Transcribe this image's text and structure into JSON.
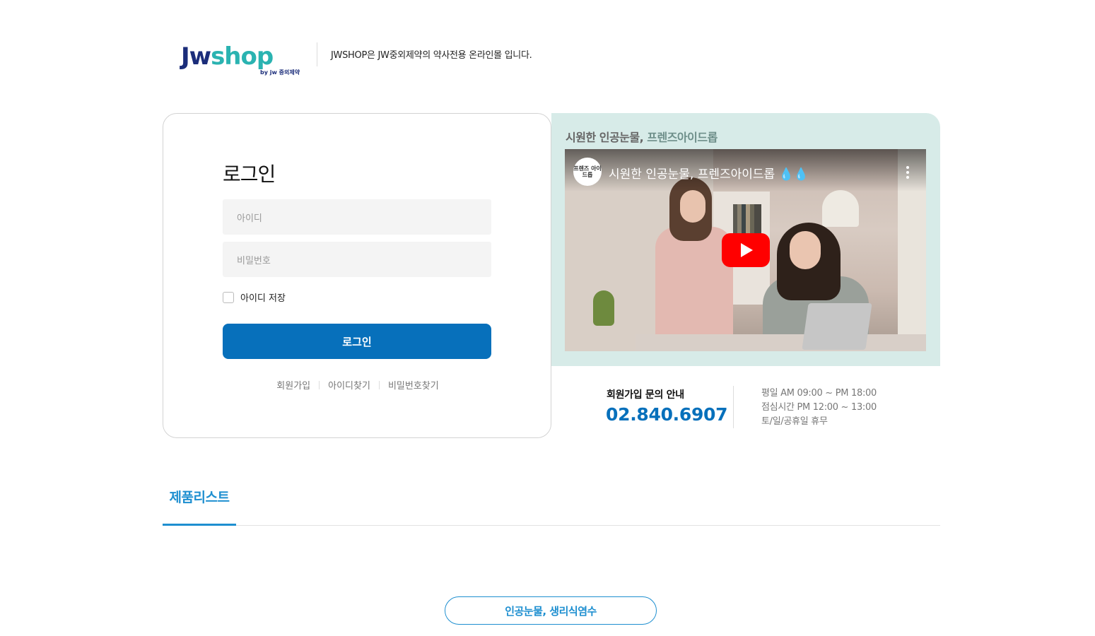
{
  "header": {
    "logo_main_jw": "Jw",
    "logo_main_shop": "shop",
    "logo_by": "by jw 중외제약",
    "description": "JWSHOP은 JW중외제약의 약사전용 온라인몰 입니다."
  },
  "login": {
    "title": "로그인",
    "id_placeholder": "아이디",
    "password_placeholder": "비밀번호",
    "remember_label": "아이디 저장",
    "remember_checked": false,
    "submit_label": "로그인",
    "links": [
      "회원가입",
      "아이디찾기",
      "비밀번호찾기"
    ]
  },
  "video": {
    "heading_prefix": "시원한 인공눈물, ",
    "heading_accent": "프렌즈아이드롭",
    "title": "시원한 인공눈물, 프렌즈아이드롭 💧💧",
    "channel_avatar_text": "프렌즈 아이드롭"
  },
  "contact": {
    "label": "회원가입 문의 안내",
    "phone": "02.840.6907",
    "hours": [
      "평일 AM 09:00 ~ PM 18:00",
      "점심시간 PM 12:00 ~ 13:00",
      "토/일/공휴일 휴무"
    ]
  },
  "tabs": {
    "active_label": "제품리스트"
  },
  "categories": {
    "first": "인공눈물, 생리식염수"
  },
  "colors": {
    "primary_blue": "#0770bb",
    "accent_blue": "#1e8fd0",
    "panel_mint": "#d7ebe8",
    "youtube_red": "#ff0000"
  }
}
